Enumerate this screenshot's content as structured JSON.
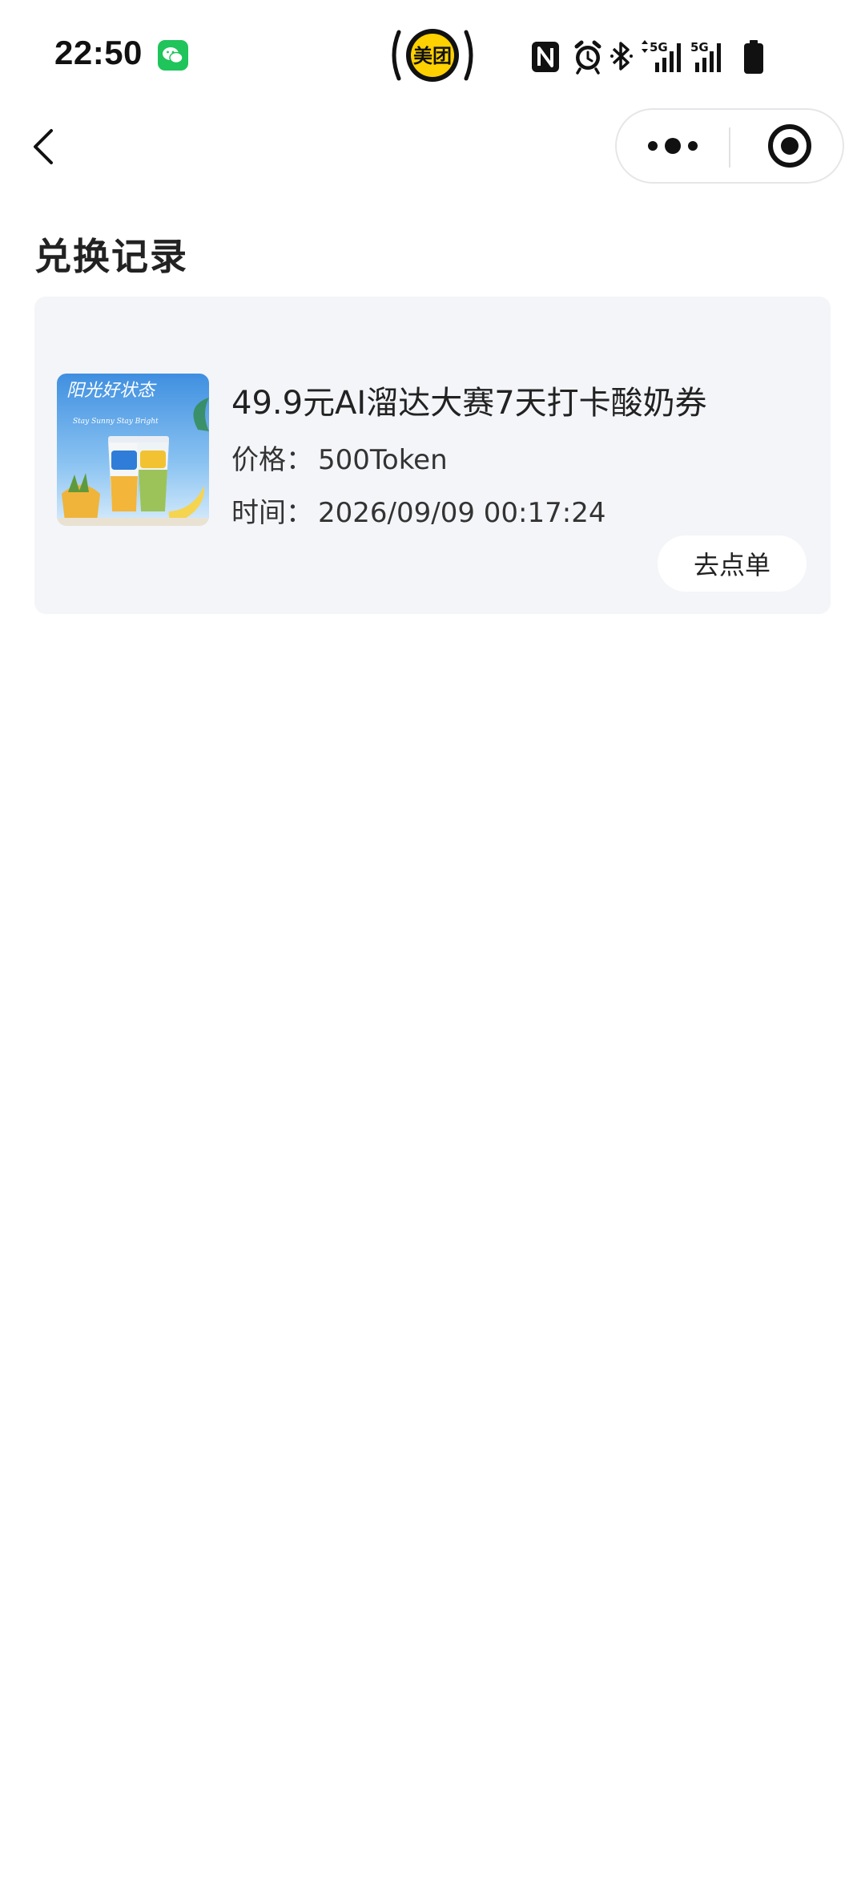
{
  "status_bar": {
    "time": "22:50",
    "icons": [
      "wechat-icon",
      "meituan-icon",
      "nfc-icon",
      "alarm-icon",
      "bluetooth-icon",
      "signal-5g-icon",
      "signal-5g-icon",
      "battery-icon"
    ],
    "meituan_label": "美团",
    "network_labels": [
      "5G",
      "5G"
    ]
  },
  "nav": {
    "back_icon": "chevron-left-icon",
    "more_icon": "more-dots-icon",
    "close_icon": "target-close-icon"
  },
  "page": {
    "title": "兑换记录"
  },
  "records": [
    {
      "image_icon": "yogurt-product-image",
      "image_text": "阳光好状态",
      "image_subtext": "Stay Sunny Stay Bright",
      "name": "49.9元AI溜达大赛7天打卡酸奶券",
      "price_label": "价格：",
      "price_value": "500Token",
      "time_label": "时间：",
      "time_value": "2026/09/09 00:17:24",
      "action_label": "去点单"
    }
  ],
  "colors": {
    "card_background": "#f4f5f9",
    "meituan_yellow": "#ffd100",
    "wechat_green": "#1fc45a"
  }
}
